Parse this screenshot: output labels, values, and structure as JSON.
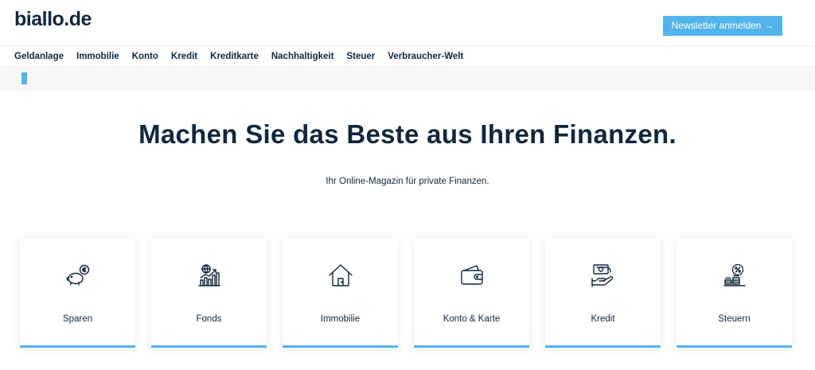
{
  "header": {
    "logo": "biallo.de",
    "newsletter_label": "Newsletter anmelden",
    "newsletter_arrow": "→"
  },
  "nav": {
    "items": [
      "Geldanlage",
      "Immobilie",
      "Konto",
      "Kredit",
      "Kreditkarte",
      "Nachhaltigkeit",
      "Steuer",
      "Verbraucher-Welt"
    ]
  },
  "hero": {
    "title": "Machen Sie das Beste aus Ihren Finanzen.",
    "subtitle": "Ihr Online-Magazin für private Finanzen."
  },
  "cards": [
    {
      "label": "Sparen",
      "icon": "piggy-bank-icon"
    },
    {
      "label": "Fonds",
      "icon": "chart-globe-icon"
    },
    {
      "label": "Immobilie",
      "icon": "house-icon"
    },
    {
      "label": "Konto & Karte",
      "icon": "wallet-icon"
    },
    {
      "label": "Kredit",
      "icon": "hand-money-icon"
    },
    {
      "label": "Steuern",
      "icon": "coins-percent-icon"
    }
  ],
  "colors": {
    "accent": "#53b4ec",
    "text": "#10273d",
    "ticker_bg": "#f6f7f8"
  }
}
